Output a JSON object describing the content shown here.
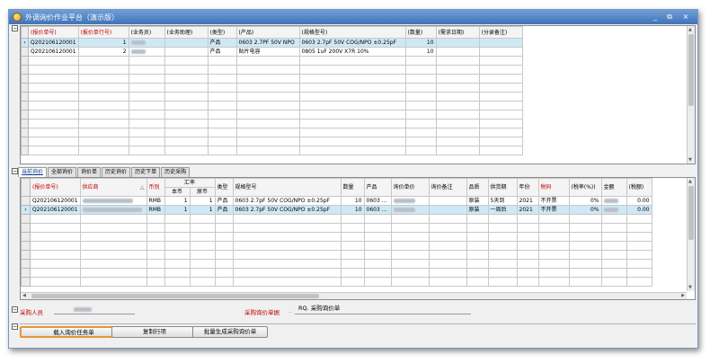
{
  "window": {
    "title": "外调询价作业平台（演示版）",
    "min": "_",
    "restore": "⧉",
    "close": "×"
  },
  "top_grid": {
    "columns": [
      "(报价单号)",
      "(报价单行号)",
      "(业务员)",
      "(业务助理)",
      "(类型)",
      "(产品)",
      "(规格型号)",
      "(数量)",
      "(需求日期)",
      "(分录备注)"
    ],
    "rows": [
      {
        "quote_no": "Q202106120001",
        "line_no": "1",
        "type": "产品",
        "product": "0603 2.7PF 50V NPO",
        "spec": "0603 2.7pF 50V COG/NPO ±0.25pF",
        "qty": "10",
        "selected": true
      },
      {
        "quote_no": "Q202106120001",
        "line_no": "2",
        "type": "产品",
        "product": "贴片电容",
        "spec": "0805 1uF 200V X7R 10%",
        "qty": "10",
        "selected": false
      }
    ]
  },
  "tabs": [
    "当前询价",
    "全部询价",
    "询价单",
    "历史询价",
    "历史下单",
    "历史采购"
  ],
  "bottom_grid": {
    "columns": {
      "quote_no": "(报价单号)",
      "supplier": "供应商",
      "currency": "币别",
      "rate_group": "汇率",
      "rate_local": "本币",
      "rate_orig": "原币",
      "type": "类型",
      "spec": "规格型号",
      "qty": "数量",
      "product": "产品",
      "inquiry_price": "询价单价",
      "inquiry_note": "询价备注",
      "quality": "品质",
      "lead_time": "供货期",
      "year": "年份",
      "tax_code": "税码",
      "tax_rate": "(税率(%))",
      "amount": "金额",
      "tax_amount": "(税额)"
    },
    "rows": [
      {
        "quote_no": "Q202106120001",
        "currency": "RMB",
        "rate_local": "1",
        "rate_orig": "1",
        "type": "产品",
        "spec": "0603 2.7pF 50V COG/NPO ±0.25pF",
        "qty": "10",
        "product": "0603 ...",
        "quality": "原装",
        "lead_time": "5天到",
        "year": "2021",
        "tax_code": "不开票",
        "tax_rate": "0%",
        "tax_amount": "0.00",
        "selected": false
      },
      {
        "quote_no": "Q202106120001",
        "currency": "RMB",
        "rate_local": "1",
        "rate_orig": "1",
        "type": "产品",
        "spec": "0603 2.7pF 50V COG/NPO ±0.25pF",
        "qty": "10",
        "product": "0603 ...",
        "quality": "原装",
        "lead_time": "一周后",
        "year": "2021",
        "tax_code": "不开票",
        "tax_rate": "0%",
        "tax_amount": "0.00",
        "selected": true
      }
    ]
  },
  "footer": {
    "purchaser_label": "采购人员",
    "voucher_label": "采购询价单据",
    "voucher_value": "RQ. 采购询价单",
    "btn_load": "载入询价任务单",
    "btn_copy": "复制行项",
    "btn_batch": "批量生成采购询价单"
  }
}
